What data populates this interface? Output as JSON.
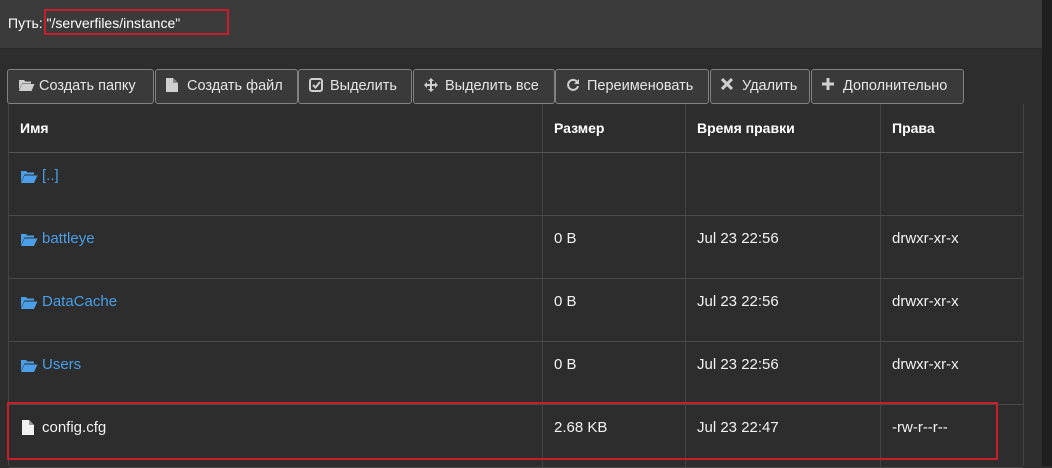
{
  "path": {
    "label": "Путь: ",
    "value": "\"/serverfiles/instance\""
  },
  "toolbar": {
    "buttons": [
      {
        "label": "Создать папку",
        "icon": "folder-open-icon"
      },
      {
        "label": "Создать файл",
        "icon": "file-icon"
      },
      {
        "label": "Выделить",
        "icon": "check-square-icon"
      },
      {
        "label": "Выделить все",
        "icon": "move-icon"
      },
      {
        "label": "Переименовать",
        "icon": "refresh-icon"
      },
      {
        "label": "Удалить",
        "icon": "close-icon"
      },
      {
        "label": "Дополнительно",
        "icon": "plus-icon"
      }
    ]
  },
  "table": {
    "columns": [
      "Имя",
      "Размер",
      "Время правки",
      "Права"
    ],
    "rows": [
      {
        "name": "[..]",
        "type": "folder",
        "size": "",
        "mtime": "",
        "perms": ""
      },
      {
        "name": "battleye",
        "type": "folder",
        "size": "0 B",
        "mtime": "Jul 23 22:56",
        "perms": "drwxr-xr-x"
      },
      {
        "name": "DataCache",
        "type": "folder",
        "size": "0 B",
        "mtime": "Jul 23 22:56",
        "perms": "drwxr-xr-x"
      },
      {
        "name": "Users",
        "type": "folder",
        "size": "0 B",
        "mtime": "Jul 23 22:56",
        "perms": "drwxr-xr-x"
      },
      {
        "name": "config.cfg",
        "type": "file",
        "size": "2.68 KB",
        "mtime": "Jul 23 22:47",
        "perms": "-rw-r--r--"
      }
    ]
  },
  "colors": {
    "link": "#4a9fe8",
    "highlight": "#c81e2b",
    "background": "#2d2d2d"
  }
}
